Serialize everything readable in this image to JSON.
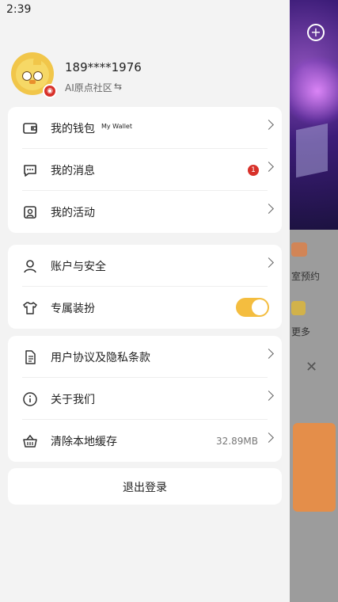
{
  "status_bar": {
    "time": "2:39"
  },
  "profile": {
    "phone": "189****1976",
    "community": "AI原点社区"
  },
  "menu_group1": [
    {
      "label": "我的钱包",
      "sub": "My Wallet"
    },
    {
      "label": "我的消息",
      "badge": "1"
    },
    {
      "label": "我的活动"
    }
  ],
  "menu_group2": [
    {
      "label": "账户与安全"
    },
    {
      "label": "专属装扮",
      "toggle_on": true
    }
  ],
  "menu_group3": [
    {
      "label": "用户协议及隐私条款"
    },
    {
      "label": "关于我们"
    },
    {
      "label": "清除本地缓存",
      "value": "32.89MB"
    }
  ],
  "logout_label": "退出登录",
  "background": {
    "text1": "室预约",
    "text2": "更多"
  },
  "colors": {
    "accent": "#f4bd3f",
    "badge": "#d8312a"
  }
}
